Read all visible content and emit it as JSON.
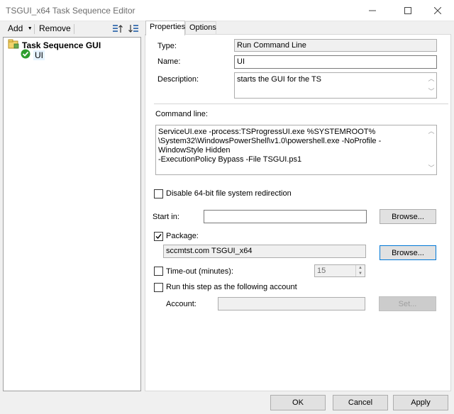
{
  "window": {
    "title": "TSGUI_x64 Task Sequence Editor"
  },
  "toolbar": {
    "add_label": "Add",
    "remove_label": "Remove"
  },
  "tree": {
    "root_label": "Task Sequence GUI",
    "child_label": "UI"
  },
  "tabs": {
    "properties": "Properties",
    "options": "Options"
  },
  "properties": {
    "type_label": "Type:",
    "type_value": "Run Command Line",
    "name_label": "Name:",
    "name_value": "UI",
    "description_label": "Description:",
    "description_value": "starts the GUI for the TS",
    "command_line_label": "Command line:",
    "command_line_value": "ServiceUI.exe -process:TSProgressUI.exe %SYSTEMROOT%\n\\System32\\WindowsPowerShell\\v1.0\\powershell.exe -NoProfile -WindowStyle Hidden\n-ExecutionPolicy Bypass -File TSGUI.ps1",
    "disable_redirection_label": "Disable 64-bit file system redirection",
    "disable_redirection_checked": false,
    "start_in_label": "Start in:",
    "start_in_value": "",
    "browse_label": "Browse...",
    "package_label": "Package:",
    "package_checked": true,
    "package_value": "sccmtst.com TSGUI_x64",
    "package_browse_label": "Browse...",
    "timeout_label": "Time-out (minutes):",
    "timeout_checked": false,
    "timeout_value": "15",
    "run_as_label": "Run this step as the following account",
    "run_as_checked": false,
    "account_label": "Account:",
    "account_value": "",
    "set_label": "Set..."
  },
  "footer": {
    "ok_label": "OK",
    "cancel_label": "Cancel",
    "apply_label": "Apply"
  }
}
